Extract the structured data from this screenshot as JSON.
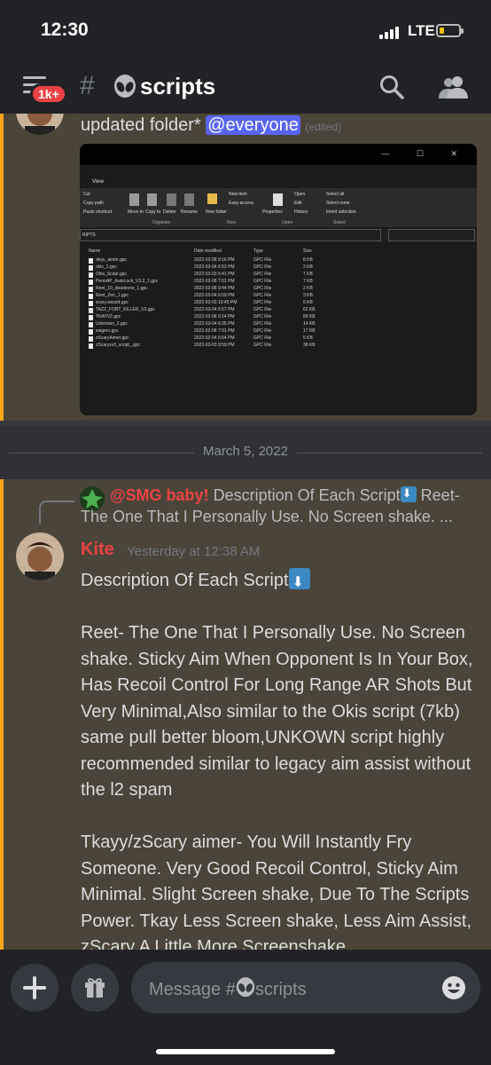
{
  "status": {
    "time": "12:30",
    "network": "LTE"
  },
  "header": {
    "badge": "1k+",
    "hash": "#",
    "channel": "scripts"
  },
  "messages": {
    "prev": {
      "text": "updated folder* ",
      "mention": "@everyone",
      "edited": "(edited)",
      "attachment": {
        "tab": "View",
        "window_controls": "— ☐ ✕",
        "ribbon": {
          "cut": "Cut",
          "copy_path": "Copy path",
          "paste_shortcut": "Paste shortcut",
          "move": "Move to",
          "copy": "Copy to",
          "delete": "Delete",
          "rename": "Rename",
          "new_folder": "New folder",
          "new_item": "New item",
          "easy_access": "Easy access",
          "properties": "Properties",
          "open": "Open",
          "edit": "Edit",
          "history": "History",
          "select_all": "Select all",
          "select_none": "Select none",
          "invert": "Invert selection",
          "organize": "Organize",
          "new": "New",
          "open_group": "Open",
          "select": "Select"
        },
        "path": "RIPTS",
        "columns": {
          "name": "Name",
          "date": "Date modified",
          "type": "Type",
          "size": "Size"
        },
        "files": [
          {
            "name": "deyy_aimm.gpc",
            "date": "2022-02-08 9:16 PM",
            "type": "GPC File",
            "size": "8 KB"
          },
          {
            "name": "okis_1.gpc",
            "date": "2022-03-04 6:53 PM",
            "type": "GPC File",
            "size": "2 KB"
          },
          {
            "name": "Okis_Script.gpc",
            "date": "2022-03-03 6:41 PM",
            "type": "GPC File",
            "size": "7 KB"
          },
          {
            "name": "PermAP_AutoLock_V3.2_1.gpc",
            "date": "2022-02-08 7:01 PM",
            "type": "GPC File",
            "size": "7 KB"
          },
          {
            "name": "Reet_10_deadzone_1.gpc",
            "date": "2022-02-08 9:44 PM",
            "type": "GPC File",
            "size": "2 KB"
          },
          {
            "name": "Reet_Zen_1.gpc",
            "date": "2022-03-04 6:59 PM",
            "type": "GPC File",
            "size": "3 KB"
          },
          {
            "name": "scary.wizard.gpc",
            "date": "2022-03-03 10:45 PM",
            "type": "GPC File",
            "size": "5 KB"
          },
          {
            "name": "TAZZ_FORT_KILLER_V3.gpc",
            "date": "2022-03-04 6:57 PM",
            "type": "GPC File",
            "size": "62 KB"
          },
          {
            "name": "TKAYV2.gpc",
            "date": "2022-02-08 9:14 PM",
            "type": "GPC File",
            "size": "89 KB"
          },
          {
            "name": "Unknown_2.gpc",
            "date": "2022-03-04 6:35 PM",
            "type": "GPC File",
            "size": "14 KB"
          },
          {
            "name": "wagers.gpc",
            "date": "2022-02-08 7:01 PM",
            "type": "GPC File",
            "size": "17 KB"
          },
          {
            "name": "zScaryAimer.gpc",
            "date": "2022-02-04 6:54 PM",
            "type": "GPC File",
            "size": "5 KB"
          },
          {
            "name": "zScaryxv3_script_.gpc",
            "date": "2022-03-03 9:59 PM",
            "type": "GPC File",
            "size": "38 KB"
          }
        ]
      }
    },
    "date_divider": "March 5, 2022",
    "current": {
      "reply": {
        "author": "@SMG baby!",
        "line1": "Description Of Each Script",
        "line1_after": "Reet-",
        "line2": "The One That I Personally Use. No Screen shake. ..."
      },
      "author": "Kite",
      "timestamp": "Yesterday at 12:38 AM",
      "title": "Description Of Each Script",
      "p1": "Reet- The One That I Personally Use. No Screen shake. Sticky Aim When Opponent Is In Your Box, Has Recoil Control For Long Range AR Shots But Very Minimal,Also similar to the Okis script (7kb) same pull better bloom,UNKOWN script highly recommended similar to legacy aim assist without the l2 spam",
      "p2": "Tkayy/zScary aimer- You Will Instantly Fry Someone. Very Good Recoil Control, Sticky Aim Minimal. Slight Screen shake, Due To The Scripts Power. Tkay Less Screen shake, Less Aim Assist, zScary A Little More Screenshake"
    }
  },
  "composer": {
    "placeholder_prefix": "Message #",
    "placeholder_channel": "scripts"
  },
  "colors": {
    "accent": "#5865f2",
    "author": "#ed4245",
    "highlight_bar": "#faa61a"
  }
}
